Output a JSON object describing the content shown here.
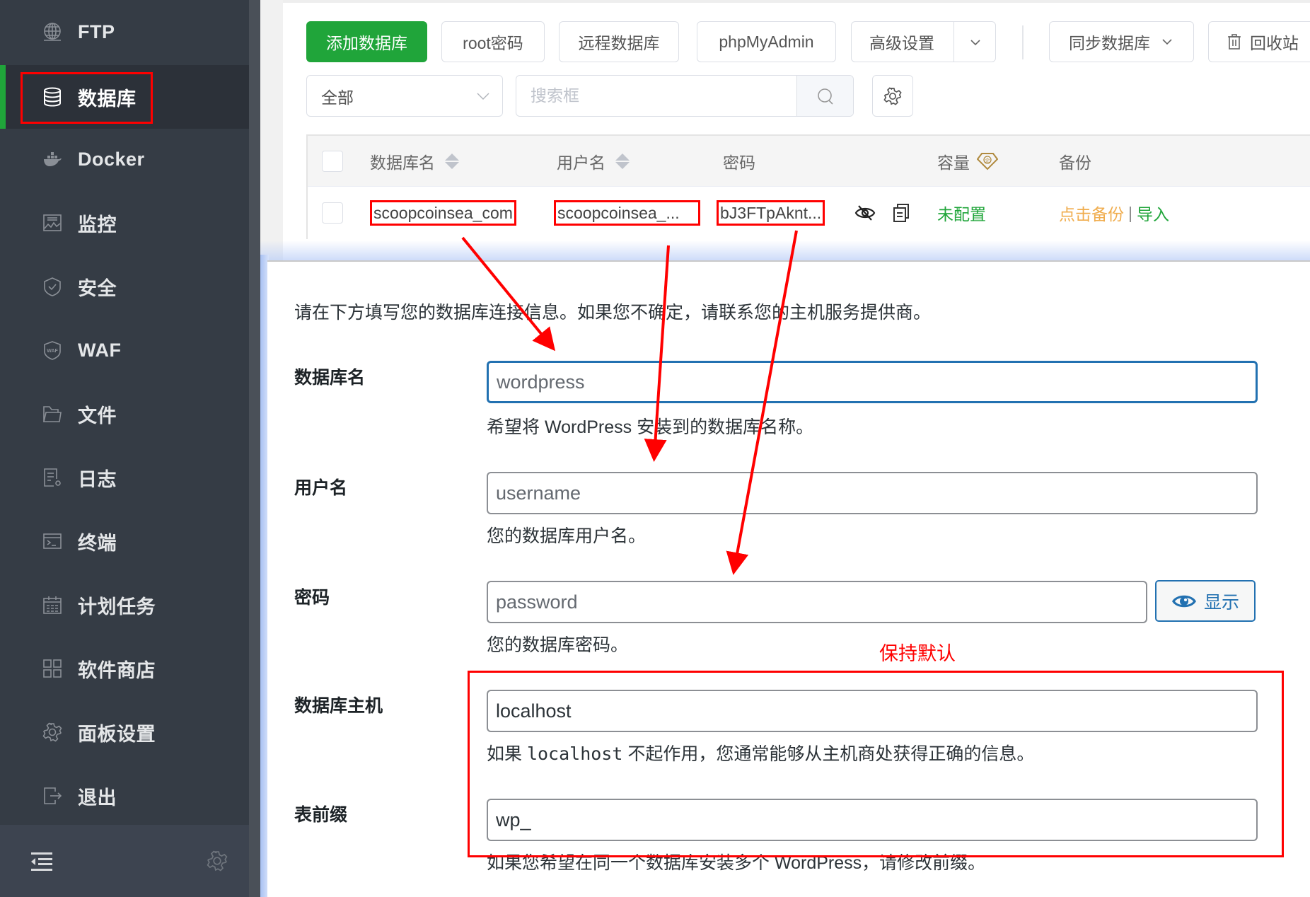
{
  "sidebar": {
    "items": [
      {
        "label": "FTP",
        "icon": "globe-icon"
      },
      {
        "label": "数据库",
        "icon": "database-icon",
        "active": true
      },
      {
        "label": "Docker",
        "icon": "docker-icon"
      },
      {
        "label": "监控",
        "icon": "monitor-icon"
      },
      {
        "label": "安全",
        "icon": "shield-icon"
      },
      {
        "label": "WAF",
        "icon": "waf-shield-icon"
      },
      {
        "label": "文件",
        "icon": "folder-icon"
      },
      {
        "label": "日志",
        "icon": "log-icon"
      },
      {
        "label": "终端",
        "icon": "terminal-icon"
      },
      {
        "label": "计划任务",
        "icon": "calendar-icon"
      },
      {
        "label": "软件商店",
        "icon": "grid-icon"
      },
      {
        "label": "面板设置",
        "icon": "gear-icon"
      },
      {
        "label": "退出",
        "icon": "logout-icon"
      }
    ],
    "accent": "#20a53a"
  },
  "toolbar": {
    "add_database": "添加数据库",
    "root_password": "root密码",
    "remote_database": "远程数据库",
    "phpmyadmin": "phpMyAdmin",
    "advanced_settings": "高级设置",
    "sync_database": "同步数据库",
    "recycle_bin": "回收站"
  },
  "filter": {
    "select_value": "全部",
    "search_placeholder": "搜索框"
  },
  "table": {
    "headers": {
      "name": "数据库名",
      "user": "用户名",
      "password": "密码",
      "capacity": "容量",
      "backup": "备份"
    },
    "rows": [
      {
        "name": "scoopcoinsea_com",
        "user": "scoopcoinsea_...",
        "password": "bJ3FTpAknt...",
        "capacity": "未配置",
        "backup": "点击备份",
        "import": "导入"
      }
    ]
  },
  "wp_form": {
    "intro": "请在下方填写您的数据库连接信息。如果您不确定，请联系您的主机服务提供商。",
    "fields": [
      {
        "label": "数据库名",
        "value": "wordpress",
        "desc": "希望将 WordPress 安装到的数据库名称。"
      },
      {
        "label": "用户名",
        "value": "username",
        "desc": "您的数据库用户名。"
      },
      {
        "label": "密码",
        "value": "password",
        "desc": "您的数据库密码。"
      },
      {
        "label": "数据库主机",
        "value": "localhost",
        "desc_pre": "如果 ",
        "desc_code": "localhost",
        "desc_post": " 不起作用，您通常能够从主机商处获得正确的信息。"
      },
      {
        "label": "表前缀",
        "value": "wp_",
        "desc": "如果您希望在同一个数据库安装多个 WordPress，请修改前缀。"
      }
    ],
    "show_button": "显示"
  },
  "annotation": {
    "keep_default": "保持默认"
  }
}
